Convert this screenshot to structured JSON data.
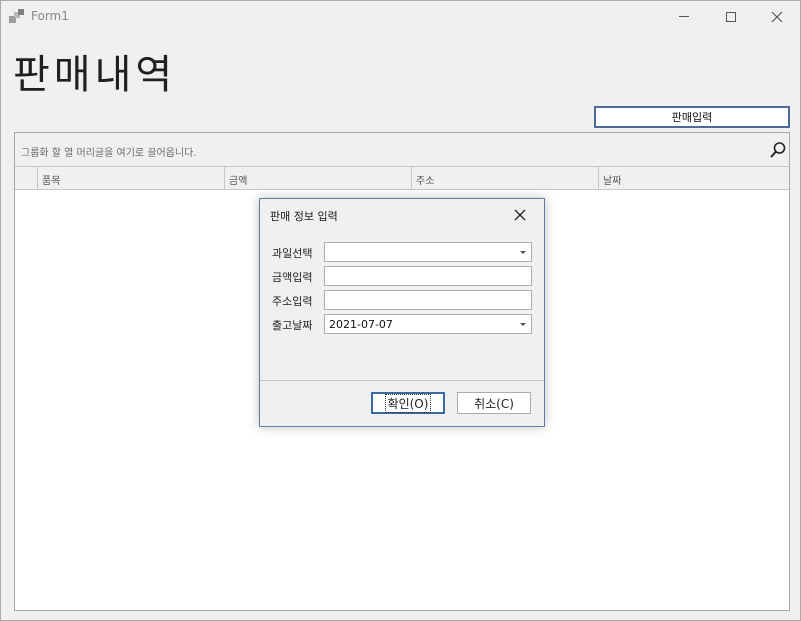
{
  "window": {
    "title": "Form1",
    "icon": "app-form-icon",
    "controls": {
      "minimize": "minimize-icon",
      "maximize": "maximize-icon",
      "close": "close-icon"
    }
  },
  "page": {
    "title": "판매내역",
    "input_button_label": "판매입력"
  },
  "grid": {
    "group_panel_text": "그룹화 할 열 머리글을 여기로 끌어옵니다.",
    "search_icon": "search-icon",
    "columns": [
      "품목",
      "금액",
      "주소",
      "날짜"
    ]
  },
  "dialog": {
    "title": "판매 정보 입력",
    "fields": [
      {
        "label": "과일선택",
        "value": "",
        "type": "combo"
      },
      {
        "label": "금액입력",
        "value": "",
        "type": "text"
      },
      {
        "label": "주소입력",
        "value": "",
        "type": "text"
      },
      {
        "label": "출고날짜",
        "value": "2021-07-07",
        "type": "date"
      }
    ],
    "ok_label": "확인(O)",
    "cancel_label": "취소(C)"
  },
  "colors": {
    "accent_border": "#4a6a9a",
    "dialog_border": "#5d7ea8",
    "window_bg": "#f0f0f0"
  }
}
